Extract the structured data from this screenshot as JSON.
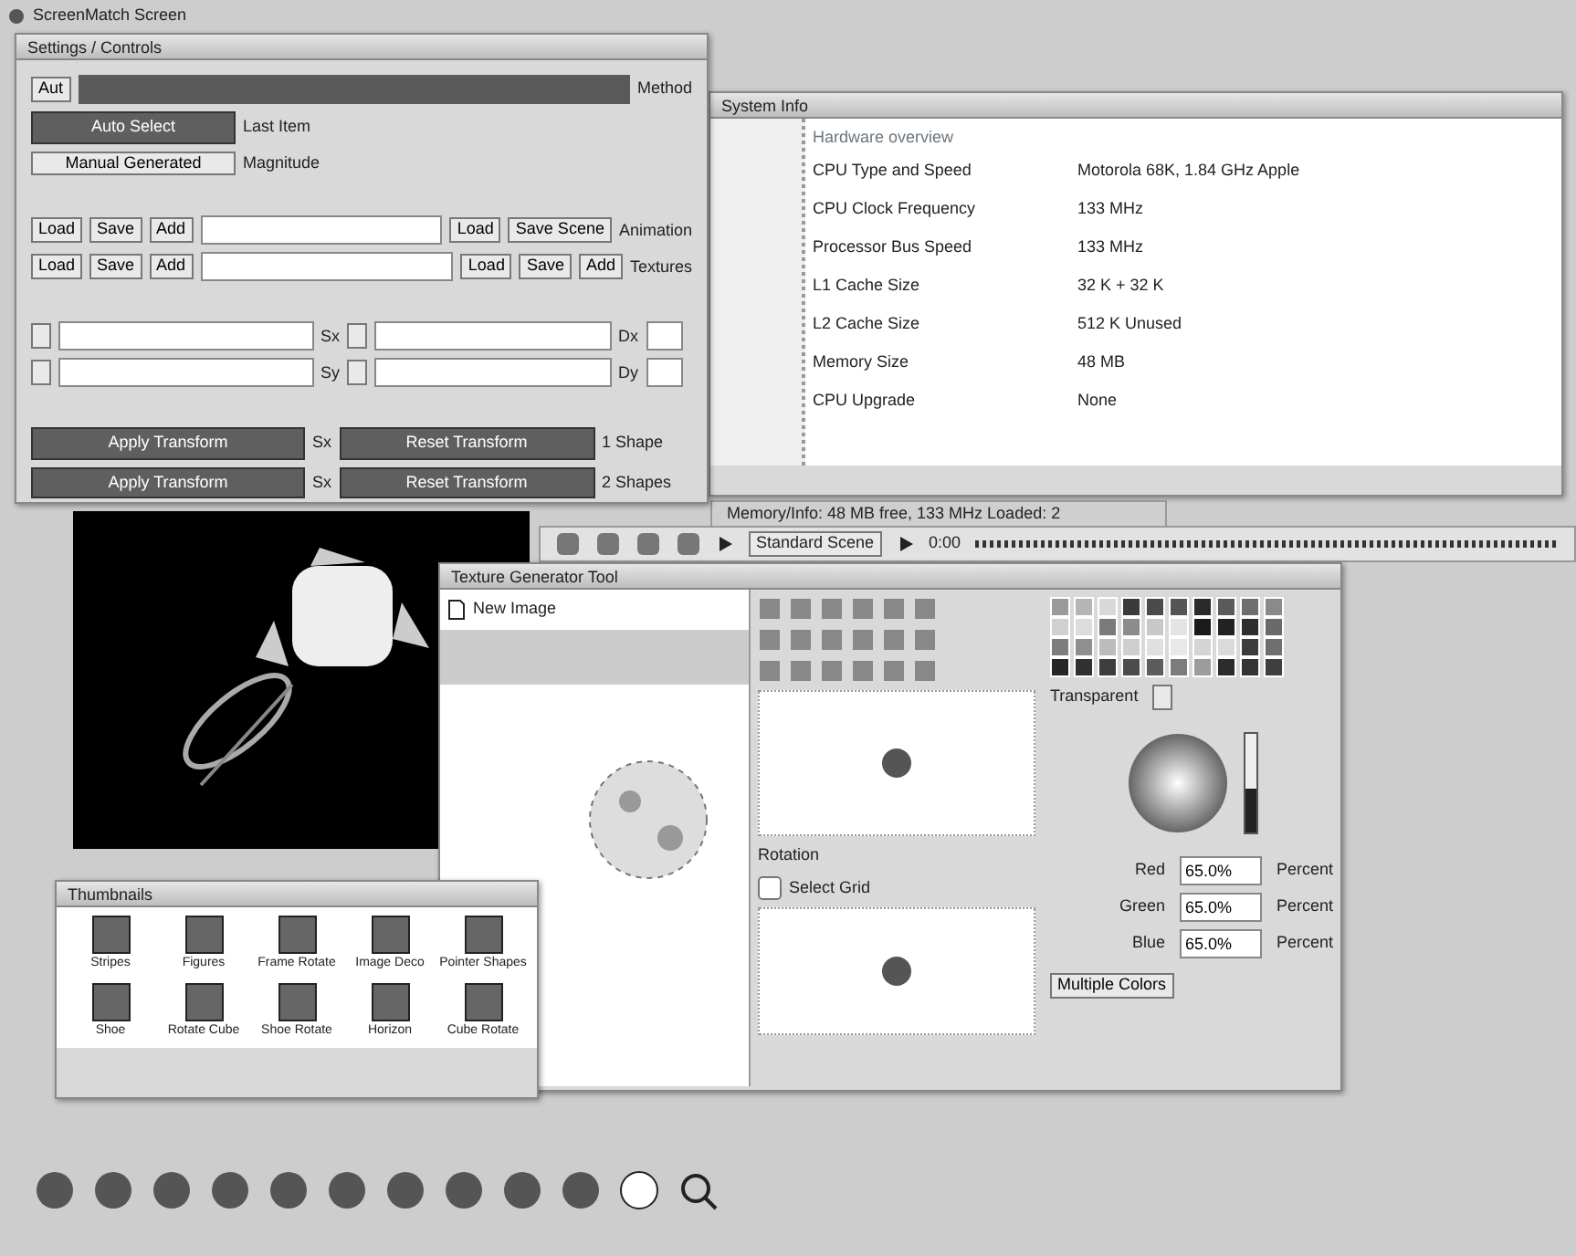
{
  "desktop_title": "ScreenMatch Screen",
  "control_window": {
    "tab": "Settings / Controls",
    "method_row": {
      "button": "Aut",
      "label": "Method"
    },
    "mode_rows": [
      {
        "button": "Auto Select",
        "label": "Last Item",
        "selected": true
      },
      {
        "button": "Manual Generated",
        "label": "Magnitude",
        "selected": false
      }
    ],
    "file_rows": [
      {
        "left": [
          "Load",
          "Save",
          "Add"
        ],
        "field": "",
        "right": [
          "Load",
          "Save Scene"
        ],
        "label": "Animation"
      },
      {
        "left": [
          "Load",
          "Save",
          "Add"
        ],
        "field": "",
        "right": [
          "Load",
          "Save",
          "Add"
        ],
        "label": "Textures"
      }
    ],
    "axis_rows": [
      {
        "a": "Sx",
        "b": "Dx"
      },
      {
        "a": "Sy",
        "b": "Dy"
      }
    ],
    "action_rows": [
      {
        "first": "Apply Transform",
        "mid": "Sx",
        "second": "Reset Transform",
        "label": "1 Shape"
      },
      {
        "first": "Apply Transform",
        "mid": "Sx",
        "second": "Reset Transform",
        "label": "2 Shapes"
      }
    ]
  },
  "info_window": {
    "title": "System Info",
    "heading": "Hardware overview",
    "rows": [
      {
        "label": "CPU Type and Speed",
        "value": "Motorola 68K, 1.84 GHz Apple"
      },
      {
        "label": "CPU Clock Frequency",
        "value": "133 MHz"
      },
      {
        "label": "Processor Bus Speed",
        "value": "133 MHz"
      },
      {
        "label": "L1 Cache Size",
        "value": "32 K + 32 K"
      },
      {
        "label": "L2 Cache Size",
        "value": "512 K Unused"
      },
      {
        "label": "Memory Size",
        "value": "48 MB"
      },
      {
        "label": "CPU Upgrade",
        "value": "None"
      }
    ],
    "status": "Memory/Info: 48 MB free, 133 MHz  Loaded: 2"
  },
  "player_bar": {
    "track": "Standard Scene",
    "time": "0:00"
  },
  "paint_window": {
    "title": "Texture Generator Tool",
    "panel_title": "New Image",
    "swatches": [
      {
        "color": "#9a9a9a"
      },
      {
        "color": "#b5b5b5"
      },
      {
        "color": "#d8d8d8"
      },
      {
        "color": "#3a3a3a"
      },
      {
        "color": "#4a4a4a"
      },
      {
        "color": "#555555"
      },
      {
        "color": "#2a2a2a"
      },
      {
        "color": "#5a5a5a"
      },
      {
        "color": "#6e6e6e"
      },
      {
        "color": "#8a8a8a"
      },
      {
        "color": "#d0d0d0"
      },
      {
        "color": "#dcdcdc"
      },
      {
        "color": "#7a7a7a"
      },
      {
        "color": "#8c8c8c"
      },
      {
        "color": "#c8c8c8"
      },
      {
        "color": "#e4e4e4"
      },
      {
        "color": "#1a1a1a"
      },
      {
        "color": "#222222"
      },
      {
        "color": "#2e2e2e"
      },
      {
        "color": "#6a6a6a"
      },
      {
        "color": "#7d7d7d"
      },
      {
        "color": "#8f8f8f"
      },
      {
        "color": "#bcbcbc"
      },
      {
        "color": "#cfcfcf"
      },
      {
        "color": "#e0e0e0"
      },
      {
        "color": "#e8e8e8"
      },
      {
        "color": "#d4d4d4"
      },
      {
        "color": "#dadada"
      },
      {
        "color": "#3c3c3c"
      },
      {
        "color": "#6f6f6f"
      },
      {
        "color": "#262626"
      },
      {
        "color": "#303030"
      },
      {
        "color": "#3d3d3d"
      },
      {
        "color": "#4c4c4c"
      },
      {
        "color": "#5c5c5c"
      },
      {
        "color": "#7c7c7c"
      },
      {
        "color": "#9c9c9c"
      },
      {
        "color": "#2c2c2c"
      },
      {
        "color": "#343434"
      },
      {
        "color": "#3f3f3f"
      }
    ],
    "transparent_label": "Transparent",
    "preview_label": "Rotation",
    "grid_check": {
      "label": "Select Grid",
      "checked": false
    },
    "brightness": {
      "level": 0.45
    },
    "channels": [
      {
        "name": "Red",
        "value": "65.0%",
        "unit": "Percent"
      },
      {
        "name": "Green",
        "value": "65.0%",
        "unit": "Percent"
      },
      {
        "name": "Blue",
        "value": "65.0%",
        "unit": "Percent"
      }
    ],
    "button": "Multiple Colors"
  },
  "thumb_window": {
    "title": "Thumbnails",
    "items": [
      {
        "label": "Stripes"
      },
      {
        "label": "Figures"
      },
      {
        "label": "Frame Rotate"
      },
      {
        "label": "Image Deco"
      },
      {
        "label": "Pointer Shapes"
      },
      {
        "label": "Shoe"
      },
      {
        "label": "Rotate Cube"
      },
      {
        "label": "Shoe Rotate"
      },
      {
        "label": "Horizon"
      },
      {
        "label": "Cube Rotate"
      }
    ]
  }
}
